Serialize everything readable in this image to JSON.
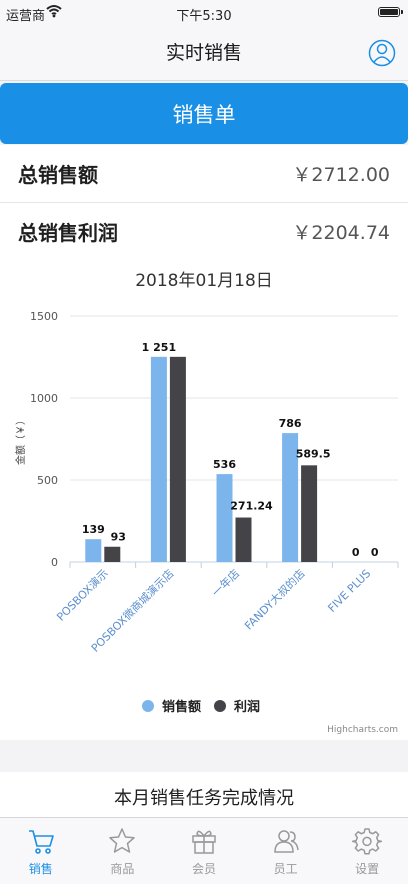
{
  "status_bar": {
    "carrier": "运营商",
    "time": "下午5:30"
  },
  "nav": {
    "title": "实时销售"
  },
  "sales_order_button": "销售单",
  "summary": {
    "total_sales_label": "总销售额",
    "total_sales_value": "￥2712.00",
    "total_profit_label": "总销售利润",
    "total_profit_value": "￥2204.74"
  },
  "chart_data": {
    "type": "bar",
    "title": "2018年01月18日",
    "ylabel": "金额（￥）",
    "xlabel": "",
    "ylim": [
      0,
      1500
    ],
    "yticks": [
      "0",
      "500",
      "1000",
      "1500"
    ],
    "categories": [
      "POSBOX演示",
      "POSBOX微商城演示店",
      "一年店",
      "FANDY大叔的店",
      "FIVE PLUS"
    ],
    "series": [
      {
        "name": "销售额",
        "values": [
          139,
          1251,
          536,
          786,
          0
        ],
        "labels": [
          "139",
          "1 251",
          "536",
          "786",
          "0"
        ],
        "color": "#7cb5ec"
      },
      {
        "name": "利润",
        "values": [
          93,
          1251,
          271.24,
          589.5,
          0
        ],
        "labels": [
          "93",
          "",
          "271.24",
          "589.5",
          "0"
        ],
        "color": "#434348"
      }
    ],
    "grid": true,
    "legend_placement": "bottom-center",
    "credits": "Highcharts.com"
  },
  "task_section": {
    "title": "本月销售任务完成情况"
  },
  "tabs": [
    {
      "label": "销售",
      "icon": "cart-icon",
      "active": true
    },
    {
      "label": "商品",
      "icon": "star-icon",
      "active": false
    },
    {
      "label": "会员",
      "icon": "gift-icon",
      "active": false
    },
    {
      "label": "员工",
      "icon": "staff-icon",
      "active": false
    },
    {
      "label": "设置",
      "icon": "gear-icon",
      "active": false
    }
  ],
  "colors": {
    "accent": "#1a8fe6",
    "sales": "#7cb5ec",
    "profit": "#434348"
  }
}
